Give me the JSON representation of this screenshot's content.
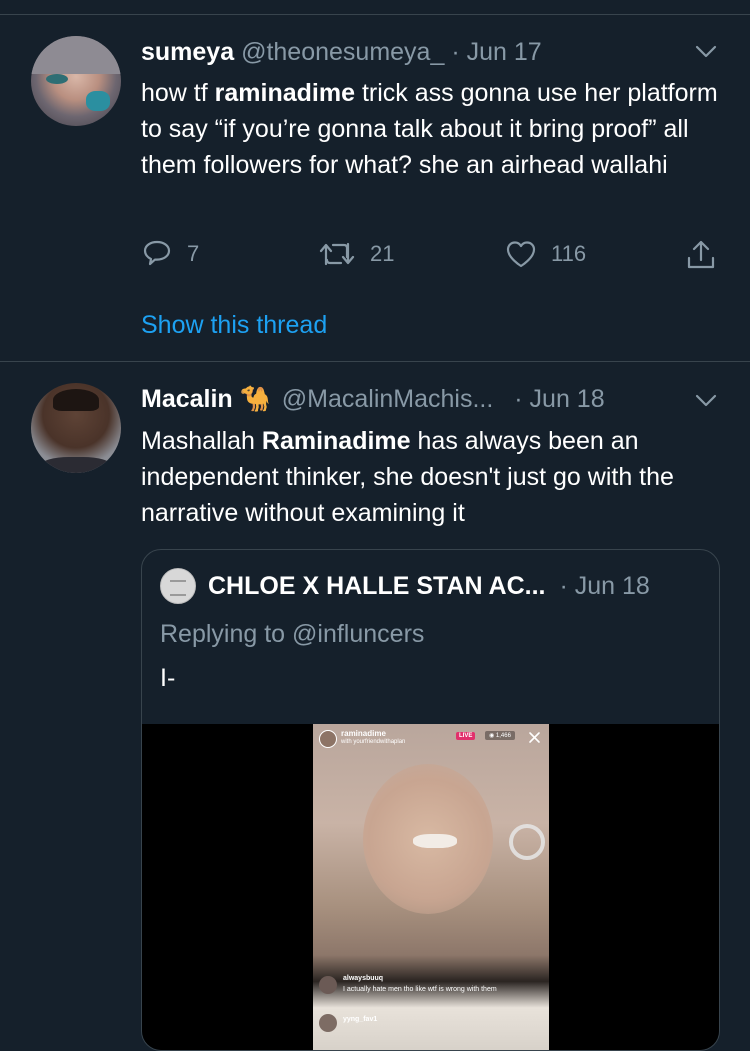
{
  "tweet1": {
    "name": "sumeya",
    "handle": "@theonesumeya_",
    "date": "· Jun 17",
    "text_prefix": "how tf ",
    "mention": "raminadime",
    "text_suffix": " trick ass gonna use her platform to say “if you’re gonna talk about it bring proof” all them followers for what? she an airhead wallahi",
    "replies": "7",
    "retweets": "21",
    "likes": "116",
    "show_thread": "Show this thread"
  },
  "tweet2": {
    "name": "Macalin",
    "emoji": "🐪",
    "handle": "@MacalinMachis...",
    "date": "· Jun 18",
    "text_prefix": "Mashallah ",
    "mention": "Raminadime",
    "text_suffix": " has always been an independent thinker, she doesn't just go with the narrative without examining it"
  },
  "quoted": {
    "name": "CHLOE X HALLE STAN AC...",
    "date": "· Jun 18",
    "replying_to": "Replying to @influncers",
    "text": "I-",
    "video": {
      "username": "raminadime",
      "subtitle": "with yourfriendwithaplan",
      "live_badge": "LIVE",
      "viewers": "1,466",
      "comment_user": "alwaysbuuq",
      "comment_text": "I actually hate men tho like wtf is wrong with them",
      "comment_user2": "yyng_fav1"
    }
  },
  "colors": {
    "background": "#15202b",
    "divider": "#38444d",
    "muted": "#8899a6",
    "link": "#1da1f2",
    "live": "#e1306c"
  }
}
